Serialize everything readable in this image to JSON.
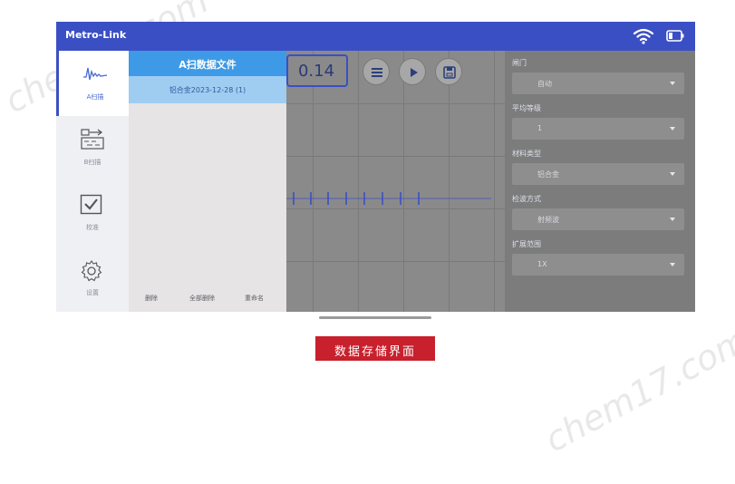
{
  "app": {
    "title": "Metro-Link"
  },
  "nav": {
    "items": [
      {
        "label": "A扫描",
        "icon": "waveform-icon",
        "active": true
      },
      {
        "label": "B扫描",
        "icon": "scan-diagram-icon",
        "active": false
      },
      {
        "label": "校准",
        "icon": "checkbox-icon",
        "active": false
      },
      {
        "label": "设置",
        "icon": "gear-icon",
        "active": false
      }
    ]
  },
  "main": {
    "value": "0.14",
    "buttons": [
      {
        "icon": "menu-icon"
      },
      {
        "icon": "play-icon"
      },
      {
        "icon": "save-icon"
      }
    ]
  },
  "drawer": {
    "title": "A扫数据文件",
    "files": [
      "铝合金2023-12-28 (1)"
    ],
    "actions": {
      "delete": "删除",
      "delete_all": "全部删除",
      "rename": "重命名"
    }
  },
  "right_panel": {
    "fields": [
      {
        "label": "闸门",
        "value": "自动"
      },
      {
        "label": "平均等级",
        "value": "1"
      },
      {
        "label": "材料类型",
        "value": "铝合金"
      },
      {
        "label": "检波方式",
        "value": "射频波"
      },
      {
        "label": "扩展范围",
        "value": "1X"
      }
    ]
  },
  "caption": {
    "text": "数据存储界面"
  },
  "watermark": {
    "text": "chem17.com"
  },
  "colors": {
    "primary": "#3b4fc4",
    "drawer_header": "#3e9ae6",
    "caption_bg": "#c8202c"
  }
}
